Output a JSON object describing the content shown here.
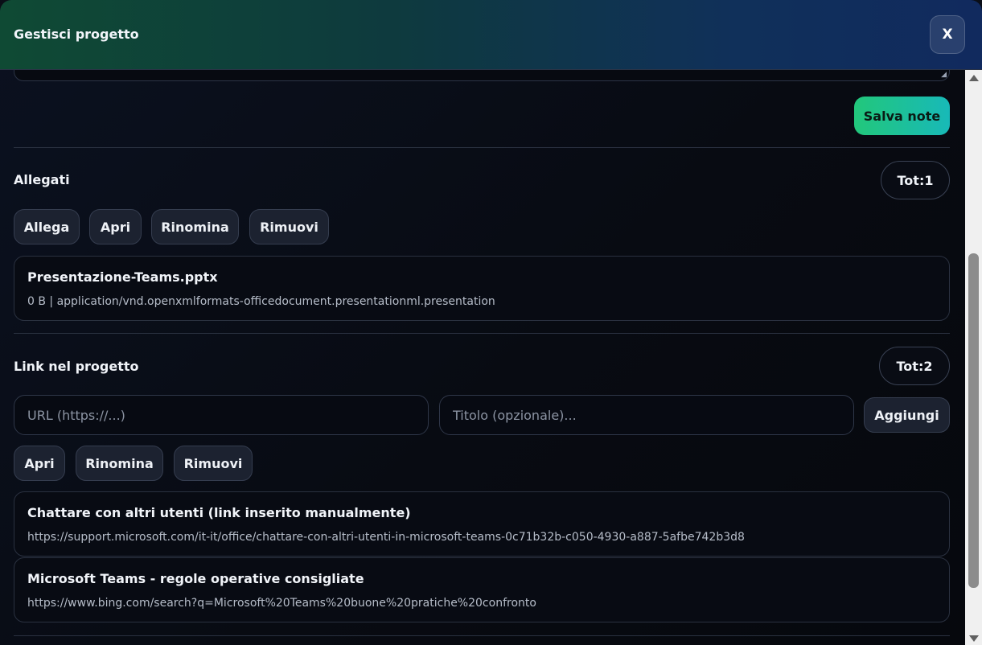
{
  "header": {
    "title": "Gestisci progetto",
    "close_label": "X"
  },
  "notes": {
    "save_label": "Salva note"
  },
  "attachments": {
    "title": "Allegati",
    "total_label": "Tot:",
    "total_count": "1",
    "actions": {
      "attach": "Allega",
      "open": "Apri",
      "rename": "Rinomina",
      "remove": "Rimuovi"
    },
    "items": [
      {
        "name": "Presentazione-Teams.pptx",
        "meta": "0 B | application/vnd.openxmlformats-officedocument.presentationml.presentation"
      }
    ]
  },
  "links": {
    "title": "Link nel progetto",
    "total_label": "Tot:",
    "total_count": "2",
    "url_placeholder": "URL (https://...)",
    "title_placeholder": "Titolo (opzionale)...",
    "add_label": "Aggiungi",
    "actions": {
      "open": "Apri",
      "rename": "Rinomina",
      "remove": "Rimuovi"
    },
    "items": [
      {
        "title": "Chattare con altri utenti (link inserito manualmente)",
        "url": "https://support.microsoft.com/it-it/office/chattare-con-altri-utenti-in-microsoft-teams-0c71b32b-c050-4930-a887-5afbe742b3d8"
      },
      {
        "title": "Microsoft Teams - regole operative consigliate",
        "url": "https://www.bing.com/search?q=Microsoft%20Teams%20buone%20pratiche%20confronto"
      }
    ]
  }
}
